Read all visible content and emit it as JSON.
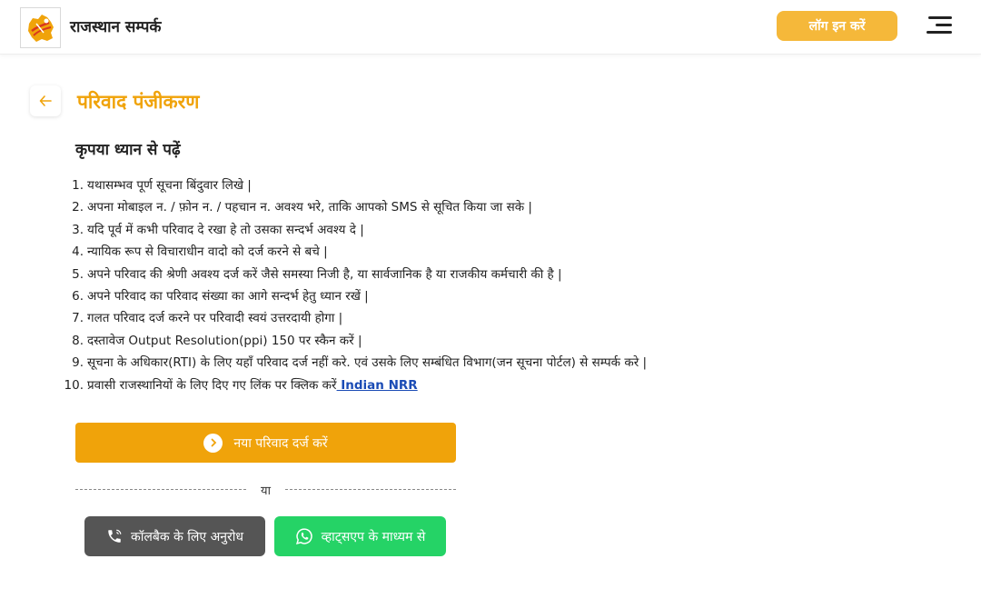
{
  "header": {
    "brand": "राजस्थान सम्पर्क",
    "login_label": "लॉग इन करें"
  },
  "page": {
    "title": "परिवाद पंजीकरण",
    "notice_heading": "कृपया ध्यान से पढ़ें",
    "instructions": [
      {
        "num": "1.",
        "text": "यथासम्भव पूर्ण सूचना बिंदुवार लिखे |"
      },
      {
        "num": "2.",
        "text": "अपना मोबाइल न. / फ़ोन न. / पहचान न. अवश्य भरे, ताकि आपको SMS से सूचित किया जा सके |"
      },
      {
        "num": "3.",
        "text": "यदि पूर्व में कभी परिवाद दे रखा हे तो उसका सन्दर्भ अवश्य दे |"
      },
      {
        "num": "4.",
        "text": "न्यायिक रूप से विचाराधीन वादो को दर्ज करने से बचे |"
      },
      {
        "num": "5.",
        "text": "अपने परिवाद की श्रेणी अवश्य दर्ज करें जैसे समस्या निजी है, या सार्वजानिक है या राजकीय कर्मचारी की है |"
      },
      {
        "num": "6.",
        "text": "अपने परिवाद का परिवाद संख्या का आगे सन्दर्भ हेतु ध्यान रखें |"
      },
      {
        "num": "7.",
        "text": "गलत परिवाद दर्ज करने पर परिवादी स्वयं उत्तरदायी होगा |"
      },
      {
        "num": "8.",
        "text": "दस्तावेज Output Resolution(ppi) 150 पर स्कैन करें |"
      },
      {
        "num": "9.",
        "text": "सूचना के अधिकार(RTI) के लिए यहाँ परिवाद दर्ज नहीं करे. एवं उसके लिए सम्बंधित विभाग(जन सूचना पोर्टल) से सम्पर्क करे |"
      },
      {
        "num": "10.",
        "text": "प्रवासी राजस्थानियों के लिए दिए गए लिंक पर क्लिक करें",
        "link": " Indian NRR"
      }
    ],
    "new_complaint_label": "नया परिवाद दर्ज करें",
    "or_label": "या",
    "callback_label": "कॉलबैक के लिए अनुरोध",
    "whatsapp_label": "व्हाट्सएप के माध्यम से"
  },
  "colors": {
    "accent": "#f0a30a",
    "login": "#f5b83a",
    "callback": "#555555",
    "whatsapp": "#25d366",
    "link": "#1a4bb5"
  }
}
